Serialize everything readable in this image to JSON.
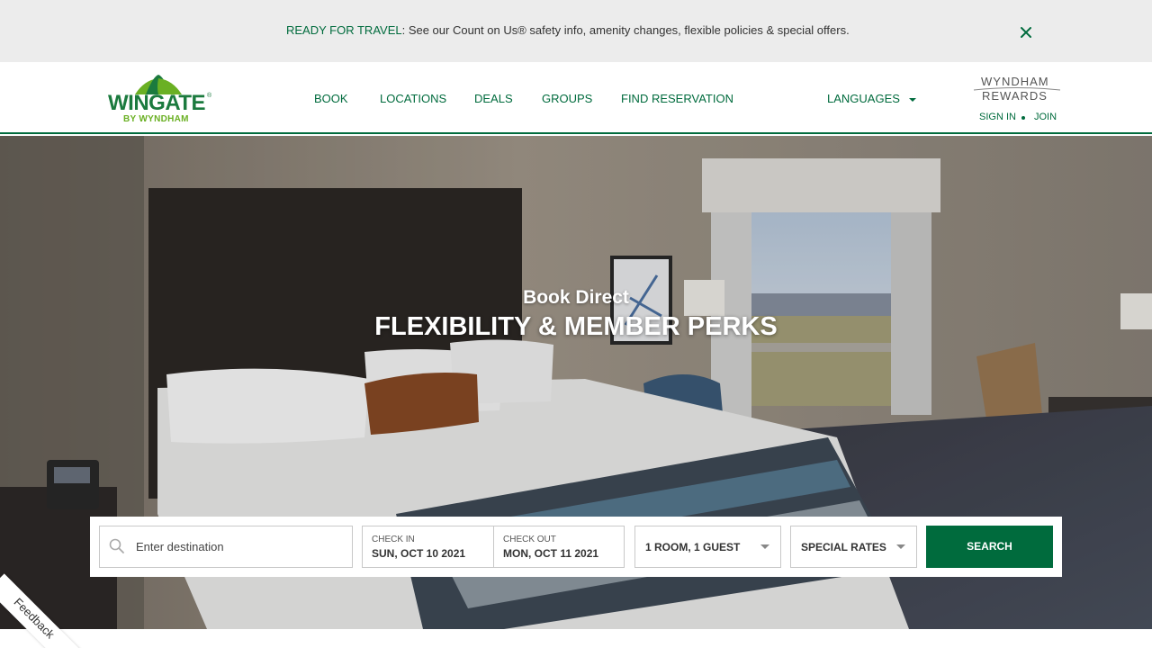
{
  "alert": {
    "lead": "READY FOR TRAVEL",
    "message": ": See our Count on Us® safety info, amenity changes, flexible policies & special offers.",
    "close_icon": "close-icon"
  },
  "brand": {
    "wordmark": "WINGATE",
    "registered": "®",
    "sub": "BY WYNDHAM",
    "color": "#006b3d",
    "accent": "#6ab023"
  },
  "nav": {
    "book": "BOOK",
    "locations": "LOCATIONS",
    "deals": "DEALS",
    "groups": "GROUPS",
    "find_reservation": "FIND RESERVATION",
    "languages": "LANGUAGES"
  },
  "rewards": {
    "line1": "WYNDHAM",
    "line2": "REWARDS",
    "sign_in": "SIGN IN",
    "join": "JOIN"
  },
  "hero": {
    "kicker": "Book Direct",
    "title": "FLEXIBILITY & MEMBER PERKS"
  },
  "booking": {
    "destination_placeholder": "Enter destination",
    "check_in_label": "CHECK IN",
    "check_in_value": "SUN, OCT 10 2021",
    "check_out_label": "CHECK OUT",
    "check_out_value": "MON, OCT 11 2021",
    "rooms_guests": "1 ROOM, 1 GUEST",
    "special_rates": "SPECIAL RATES",
    "search": "SEARCH"
  },
  "feedback": {
    "label": "Feedback"
  }
}
